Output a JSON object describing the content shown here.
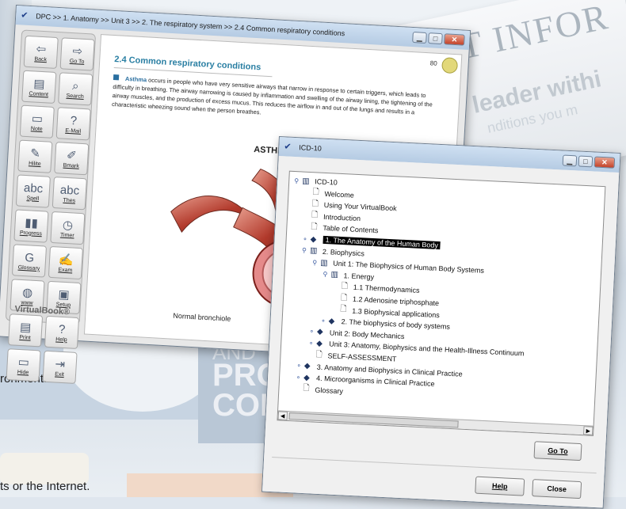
{
  "background": {
    "title_fragment": "ENT INFOR",
    "sub_fragment": "leader withi",
    "sub_fragment2": "nditions you m",
    "and_word": "AND",
    "pro_word": "PRO",
    "co_word": "COI",
    "sentence1": "ronment.",
    "sentence2": "ts or the Internet."
  },
  "dpc": {
    "title": "DPC >> 1. Anatomy >> Unit 3 >> 2. The respiratory system >> 2.4 Common respiratory conditions",
    "toolbar": [
      {
        "icon": "back-icon",
        "glyph": "⇦",
        "label": "Back"
      },
      {
        "icon": "goto-icon",
        "glyph": "⇨",
        "label": "Go To"
      },
      {
        "icon": "content-icon",
        "glyph": "▤",
        "label": "Content"
      },
      {
        "icon": "search-icon",
        "glyph": "⌕",
        "label": "Search"
      },
      {
        "icon": "note-icon",
        "glyph": "▭",
        "label": "Note"
      },
      {
        "icon": "email-icon",
        "glyph": "?",
        "label": "E-Mail"
      },
      {
        "icon": "hilite-icon",
        "glyph": "✎",
        "label": "Hilite"
      },
      {
        "icon": "bookmark-icon",
        "glyph": "✐",
        "label": "Bmark"
      },
      {
        "icon": "spell-icon",
        "glyph": "abc",
        "label": "Spell"
      },
      {
        "icon": "thesaurus-icon",
        "glyph": "abc",
        "label": "Thes"
      },
      {
        "icon": "progress-icon",
        "glyph": "▮▮",
        "label": "Progress"
      },
      {
        "icon": "timer-icon",
        "glyph": "◷",
        "label": "Timer"
      },
      {
        "icon": "glossary-icon",
        "glyph": "G",
        "label": "Glossary"
      },
      {
        "icon": "exam-icon",
        "glyph": "✍",
        "label": "Exam"
      },
      {
        "icon": "www-icon",
        "glyph": "◍",
        "label": "www"
      },
      {
        "icon": "setup-icon",
        "glyph": "▣",
        "label": "Setup"
      },
      {
        "icon": "print-icon",
        "glyph": "▤",
        "label": "Print"
      },
      {
        "icon": "help-icon",
        "glyph": "?",
        "label": "Help"
      },
      {
        "icon": "hide-icon",
        "glyph": "▭",
        "label": "Hide"
      },
      {
        "icon": "exit-icon",
        "glyph": "⇥",
        "label": "Exit"
      }
    ],
    "brand": "VirtualBook®",
    "page_number": "80",
    "heading": "2.4 Common respiratory conditions",
    "term": "Asthma",
    "paragraph": " occurs in people who have very sensitive airways that narrow in response to certain triggers, which leads to difficulty in breathing. The airway narrowing is caused by inflammation and swelling of the airway lining, the tightening of the airway muscles, and the production of excess mucus. This reduces the airflow in and out of the lungs and results in a characteristic wheezing sound when the person breathes.",
    "figure_title": "ASTHMA",
    "figure_caption": "Normal bronchiole"
  },
  "icd": {
    "title": "ICD-10",
    "tree": [
      {
        "label": "ICD-10",
        "kind": "openbook",
        "level": 0,
        "toggle": "open"
      },
      {
        "label": "Welcome",
        "kind": "doc",
        "level": 1
      },
      {
        "label": "Using Your VirtualBook",
        "kind": "doc",
        "level": 1
      },
      {
        "label": "Introduction",
        "kind": "doc",
        "level": 1
      },
      {
        "label": "Table of Contents",
        "kind": "doc",
        "level": 1
      },
      {
        "label": "1. The Anatomy of the Human Body",
        "kind": "book",
        "level": 1,
        "toggle": "closed",
        "selected": true
      },
      {
        "label": "2. Biophysics",
        "kind": "openbook",
        "level": 1,
        "toggle": "open"
      },
      {
        "label": "Unit 1: The Biophysics of Human Body Systems",
        "kind": "openbook",
        "level": 2,
        "toggle": "open"
      },
      {
        "label": "1. Energy",
        "kind": "openbook",
        "level": 3,
        "toggle": "open"
      },
      {
        "label": "1.1 Thermodynamics",
        "kind": "doc",
        "level": 4
      },
      {
        "label": "1.2 Adenosine triphosphate",
        "kind": "doc",
        "level": 4
      },
      {
        "label": "1.3 Biophysical applications",
        "kind": "doc",
        "level": 4
      },
      {
        "label": "2. The biophysics of body systems",
        "kind": "book",
        "level": 3,
        "toggle": "closed"
      },
      {
        "label": "Unit 2: Body Mechanics",
        "kind": "book",
        "level": 2,
        "toggle": "closed"
      },
      {
        "label": "Unit 3: Anatomy, Biophysics and the Health-Illness Continuum",
        "kind": "book",
        "level": 2,
        "toggle": "closed"
      },
      {
        "label": "SELF-ASSESSMENT",
        "kind": "doc",
        "level": 2
      },
      {
        "label": "3. Anatomy and Biophysics in Clinical Practice",
        "kind": "book",
        "level": 1,
        "toggle": "closed"
      },
      {
        "label": "4. Microorganisms in Clinical Practice",
        "kind": "book",
        "level": 1,
        "toggle": "closed"
      },
      {
        "label": "Glossary",
        "kind": "doc",
        "level": 1
      }
    ],
    "goto_label": "Go To",
    "help_label": "Help",
    "close_label": "Close"
  }
}
